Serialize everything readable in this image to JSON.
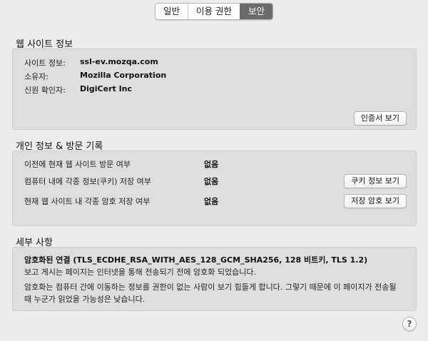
{
  "tabs": [
    {
      "label": "일반"
    },
    {
      "label": "이용 권한"
    },
    {
      "label": "보안"
    }
  ],
  "website": {
    "title": "웹 사이트 정보",
    "site_label": "사이트 정보:",
    "site_value": "ssl-ev.mozqa.com",
    "owner_label": "소유자:",
    "owner_value": "Mozilla Corporation",
    "verifier_label": "신원 확인자:",
    "verifier_value": "DigiCert Inc",
    "view_cert_button": "인증서 보기"
  },
  "privacy": {
    "title": "개인 정보 & 방문 기록",
    "visited_label": "이전에 현재 웹 사이트 방문 여부",
    "visited_value": "없음",
    "cookies_label": "컴퓨터 내에 각종 정보(쿠키) 저장 여부",
    "cookies_value": "없음",
    "cookies_button": "쿠키 정보 보기",
    "passwords_label": "현재 웹 사이트 내 각종 암호 저장 여부",
    "passwords_value": "없음",
    "passwords_button": "저장 암호 보기"
  },
  "details": {
    "title": "세부 사항",
    "connection": "암호화된 연결 (TLS_ECDHE_RSA_WITH_AES_128_GCM_SHA256, 128 비트키, TLS 1.2)",
    "line1": "보고 게시는 페이지는 인터넷을 통해 전송되기 전에 암호화 되었습니다.",
    "line2": "암호화는 컴퓨터 간에 이동하는 정보를 권한이 없는 사람이 보기 힘들게 합니다. 그렇기 때문에 이 페이지가 전송될 때 누군가 읽었을 가능성은 낮습니다."
  },
  "help": {
    "label": "?"
  }
}
